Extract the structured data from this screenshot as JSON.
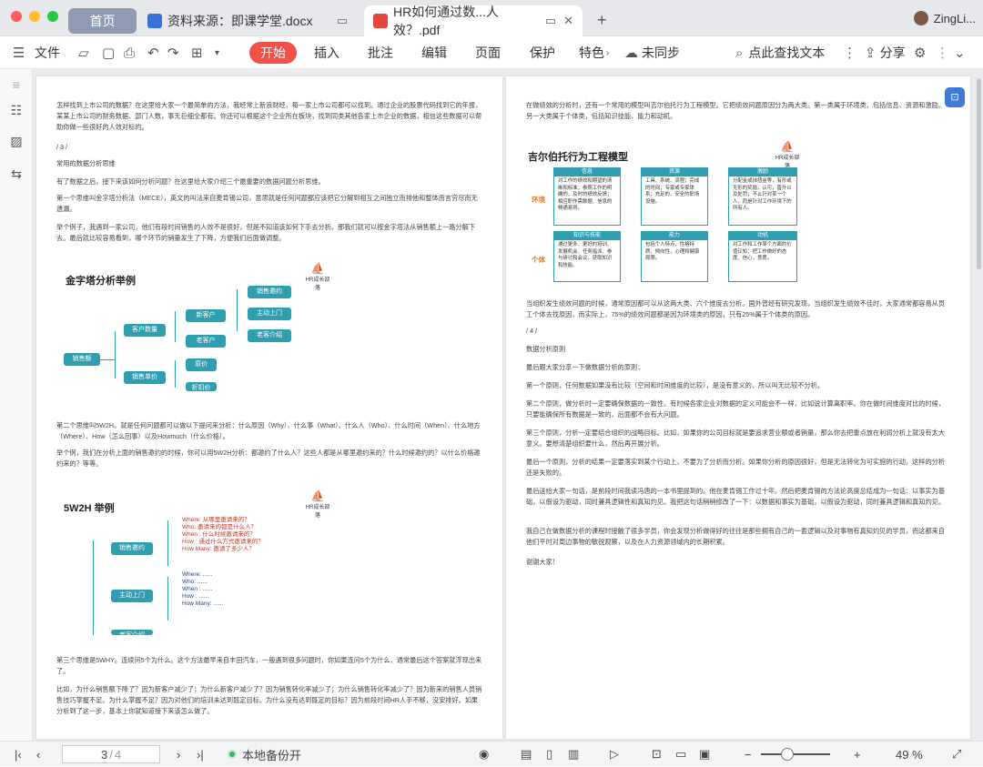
{
  "tabs": {
    "home": "首页",
    "doc": "资料来源：即课学堂.docx",
    "pdf": "HR如何通过数...人效？.pdf",
    "add": "+"
  },
  "user": {
    "name": "ZingLi..."
  },
  "toolbar": {
    "file": "文件",
    "start": "开始",
    "insert": "插入",
    "comment": "批注",
    "edit": "编辑",
    "page": "页面",
    "protect": "保护",
    "special": "特色",
    "sync": "未同步",
    "search": "点此查找文本",
    "share": "分享"
  },
  "left": {
    "p1": "怎样找到上市公司的数据？在这里给大家一个最简单的方法，我经常上新浪财经，每一家上市公司都可以找到。通过企业的股票代码找到它的年报，某某上市公司的财务数据、部门人数，事无巨细全都有。你还可以根据这个企业所在板块，找到同类其他各家上市企业的数据，相信这些数据可以帮助你做一些很好的人效对标的。",
    "p2": "/ 3 /",
    "p3": "常用的数据分析思维",
    "p4": "有了数据之后，接下来该如何分析问题？在这里给大家介绍三个最重要的数据问题分析思维。",
    "p5": "第一个思维叫金字塔分析法（MECE），英文的叫法来自麦肯锡公司，意思就是任何问题都应该把它分解到相互之间独立而排他和整体而言穷尽而无遗漏。",
    "p6": "举个例子，我遇到一家公司，他们有段时间销售的人效不是很好，但是不知道该如何下手去分析。那我们就可以按金字塔法从销售额上一路分解下去。最后就比较容易看到，哪个环节的销量发生了下降，方便我们后面做调整。",
    "fig1": {
      "title": "金字塔分析举例",
      "logo": "HR成长部落",
      "root": "销售额",
      "n1": "客户数量",
      "n2": "销售单价",
      "n11": "新客户",
      "n12": "老客户",
      "n21": "原价",
      "n22": "折扣价",
      "l1": "销售邀约",
      "l2": "主动上门",
      "l3": "老客介绍"
    },
    "p7": "第二个思维叫5W2H。就是任何问题都可以做以下提问来分析：什么原因（Why）、什么事（What）、什么人（Who）、什么时间（When）、什么地方（Where）、How（怎么回事）以及Howmuch（什么价格）。",
    "p8": "举个例，我们在分析上面的销售邀约的时候，你可以用5W2H分析：都邀约了什么人？这些人都是从哪里邀约来的？什么时候邀约的？以什么价格邀约来的？等等。",
    "fig2": {
      "title": "5W2H 举例",
      "logo": "HR成长部落",
      "n1": "销售邀约",
      "n2": "主动上门",
      "n3": "老客介绍",
      "r1": [
        "Where: 从哪里邀请来的？",
        "Who: 邀请来的都是什么人？",
        "When : 什么时候邀请来的？",
        "How : 通过什么方式邀请来的？",
        "How Many: 邀请了多少人？"
      ],
      "r2": [
        "Where: ......",
        "Who: ......",
        "When : ......",
        "How : ......",
        "How Many: ......"
      ]
    },
    "p9": "第三个思维是5WHY。连续问5个为什么。这个方法最早来自丰田汽车，一般遇到很多问题时，你如果连问5个为什么，通常最后这个答案就浮现出来了。",
    "p10": "比如，为什么销售额下降了？因为新客户减少了；为什么新客户减少了？因为销售转化率减少了；为什么销售转化率减少了？因为新来的销售人员销售技巧掌握不足。为什么掌握不足？因为对他们的培训未达到既定目标。为什么没有达到既定的目标？因为前段时间HR人手不够，没安排好。如果分析到了这一步，基本上你就知道接下来该怎么做了。"
  },
  "right": {
    "p1": "在做绩效的分析时，还有一个常用的模型叫吉尔伯托行为工程模型。它把绩效问题原因分为两大类。第一类属于环境类，包括信息、资源和激励。另一大类属于个体类，包括知识技能、能力和动机。",
    "fig": {
      "title": "吉尔伯托行为工程模型",
      "logo": "HR成长部落",
      "row1": "环境",
      "row2": "个体",
      "boxes": [
        {
          "h": "信息",
          "b": "对工作的绩效和期望的清晰和标准；参照工作的明确的、及时的绩效反馈；相应职作需数据、信息的畅通易得。"
        },
        {
          "h": "资源",
          "b": "工具、系统、流程；完成的时间；专家或专家体系；充足的、安全的职场设施。"
        },
        {
          "h": "激励",
          "b": "分配金或抹扭金等，有形或无形的奖励，认可，晋升以及处罚；不止针对某一个人，而是针对工作环境下的所有人。"
        },
        {
          "h": "知识与技能",
          "b": "通过更多、更好的培训、发展机会、任务指派、参与研讨和会议，获取知识和技能。"
        },
        {
          "h": "能力",
          "b": "包括个人特点，性格特质，倾向性，心理和健康局限。"
        },
        {
          "h": "动机",
          "b": "对工作和工作某个方面的价值认知；把工作做好的态度、信心，意愿。"
        }
      ]
    },
    "p2": "当组织发生绩效问题的时候，通常原因都可以从这两大类、六个维度去分析。国外曾经有研究发现，当组织发生绩效不佳时，大家通常都容易从员工个体去找原因，而实际上，75%的绩效问题都是因为环境类的原因，只有25%属于个体类的原因。",
    "p3": "/ 4 /",
    "p4": "数据分析原则",
    "p5": "最后跟大家分享一下做数据分析的原则：",
    "p6": "第一个原则，任何数据如果没有比较（空间和时间维度的比较），是没有意义的，所以叫无比较不分析。",
    "p7": "第二个原则，做分析时一定要确保数据的一致性。有时候各家企业对数据的定义可能会不一样，比如说计算离职率。你在做时间维度对比的时候，只要能确保所有数据是一致的，后面都不会有大问题。",
    "p8": "第三个原则，分析一定要结合组织的战略目标。比如，如果你的公司目标就是要追求营业额或者销量，那么你去把重点放在利润分析上就没有太大意义。要想清楚组织要什么，然后再开展分析。",
    "p9": "最后一个原则，分析的结果一定要落实到某个行动上，不要为了分析而分析。如果你分析的原因很好，但是无法转化为可实施的行动，这样的分析还是失败的。",
    "p10": "最后送给大家一句话，是前段时间我读冯唐的一本书里提到的。他在麦肯锡工作过十年。然后把麦肯锡的方法论高度总结成为一句话：以事实为基础，以假设为驱动，同时兼具逻辑性和真知灼见。我把这句话稍稍修改了一下：以数据和事实为基础，以假设为驱动，同时兼具逻辑和真知灼见。",
    "p11": "我自己在做数据分析的课程时接触了很多学员，你会发现分析做得好的往往是那些拥有自己的一套逻辑以及对事物有真知灼见的学员，而这都来自他们平时对周边事物的敏锐观察，以及在人力资源领域内的长期积累。",
    "p12": "谢谢大家！"
  },
  "status": {
    "page_current": "3",
    "page_sep": "/",
    "page_total": "4",
    "backup": "本地备份开",
    "zoom": "49 %"
  }
}
